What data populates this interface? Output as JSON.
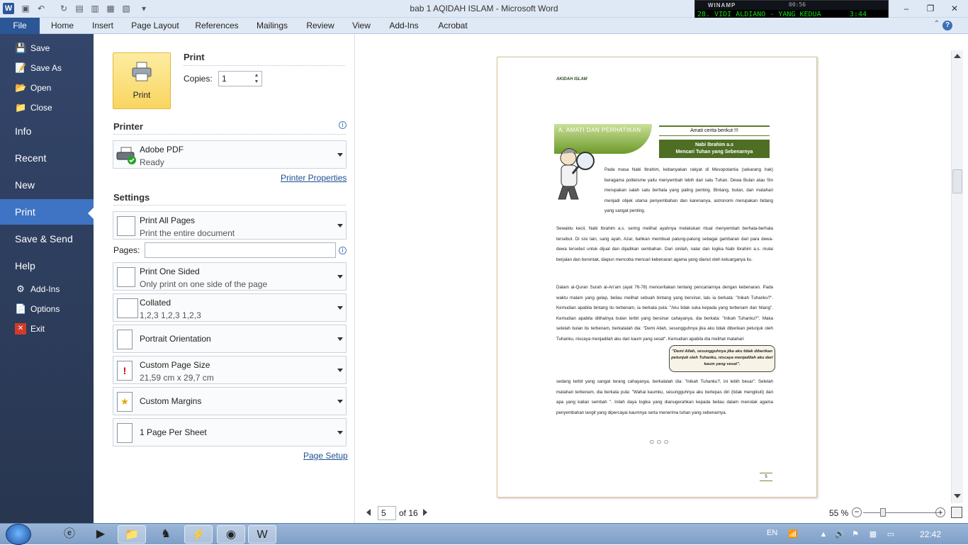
{
  "window": {
    "title": "bab 1 AQIDAH ISLAM  -  Microsoft Word",
    "app_icon": "W"
  },
  "winamp": {
    "label": "WINAMP",
    "clock": "00:56",
    "track": "28. VIDI ALDIANO - YANG KEDUA",
    "time": "3:44"
  },
  "ribbon_tabs": [
    "File",
    "Home",
    "Insert",
    "Page Layout",
    "References",
    "Mailings",
    "Review",
    "View",
    "Add-Ins",
    "Acrobat"
  ],
  "nav": {
    "save": "Save",
    "save_as": "Save As",
    "open": "Open",
    "close": "Close",
    "info": "Info",
    "recent": "Recent",
    "new": "New",
    "print": "Print",
    "save_send": "Save & Send",
    "help": "Help",
    "add_ins": "Add-Ins",
    "options": "Options",
    "exit": "Exit"
  },
  "print_panel": {
    "print_button": "Print",
    "print_heading": "Print",
    "copies_label": "Copies:",
    "copies_value": "1",
    "printer_heading": "Printer",
    "printer_name": "Adobe PDF",
    "printer_status": "Ready",
    "printer_properties": "Printer Properties",
    "settings_heading": "Settings",
    "pages_label": "Pages:",
    "page_setup": "Page Setup",
    "settings": [
      {
        "title": "Print All Pages",
        "subtitle": "Print the entire document"
      },
      {
        "title": "Print One Sided",
        "subtitle": "Only print on one side of the page"
      },
      {
        "title": "Collated",
        "subtitle": "1,2,3    1,2,3    1,2,3"
      },
      {
        "title": "Portrait Orientation",
        "subtitle": ""
      },
      {
        "title": "Custom Page Size",
        "subtitle": "21,59 cm x 29,7 cm"
      },
      {
        "title": "Custom Margins",
        "subtitle": ""
      },
      {
        "title": "1 Page Per Sheet",
        "subtitle": ""
      }
    ]
  },
  "document": {
    "header": "AKIDAH ISLAM",
    "banner": "A. AMATI DAN PERHATIKAN",
    "box_top": "Amati cerita berikut !!!",
    "box_title_1": "Nabi Ibrahim a.s",
    "box_title_2": "Mencari Tuhan yang Sebenarnya",
    "para1": "Pada masa Nabi Ibrahim, kebanyakan rakyat di Mesopotamia (sekarang Irak) beragama politeisme yaitu menyembah lebih dari satu Tuhan. Dewa Bulan atau Sin merupakan salah satu berhala yang paling penting. Bintang, bulan, dan matahari menjadi objek utama penyembahan dan karenanya, astronomi merupakan bidang yang sangat penting.",
    "para2": "Sewaktu kecil, Nabi Ibrahim a.s. sering melihat ayahnya melakukan ritual menyembah berhala-berhala tersebut. Di sisi lain, sang ayah, Azar, bahkan membuat patung-patung sebagai gambaran dari para dewa-dewa tersebut untuk dijual dan dijadikan sembahan. Dari sinilah, nalar dan logika Nabi Ibrahim a.s. mulai berjalan dan berontak, diapun mencoba mencari kebenaran agama yang dianut oleh keluarganya itu.",
    "para3": "Dalam al-Quran Surah al-An'am (ayat 76-78) menceritakan tentang pencariannya dengan kebenaran. Pada waktu malam yang gelap, beliau melihat sebuah bintang yang bersinar, lalu ia berkata: \"Inikah Tuhanku?\". Kemudian apabila bintang itu terbenam, ia berkata pula: \"Aku tidak suka kepada yang terbenam dan hilang\". Kemudian apabila dilihatnya bulan terbit yang bersinar cahayanya, dia berkata: \"Inikah Tuhanku?\". Maka setelah bulan itu terbenam, berkatalah dia: \"Demi Allah, sesungguhnya jika aku tidak diberikan petunjuk oleh Tuhanku, niscaya menjadilah aku dari kaum yang sesat\". Kemudian apabila dia melihat matahari",
    "para3_cont": "sedang terbit yang sangat terang cahayanya, berkatalah dia: \"Inikah Tuhanku?, ini lebih besar\". Setelah matahari terbenam, dia berkata pula: \"Wahai kaumku, sesungguhnya aku berlepas diri (tidak mengikuti) dari apa yang kalian sembah \". Inilah daya logika yang dianugerahkan kepada beliau dalam menolak agama penyembahan langit yang dipercayai kaumnya serta menerima tuhan yang sebenarnya.",
    "quote": "\"Demi Allah, sesungguhnya jika aku tidak diberikan petunjuk oleh Tuhanku, niscaya menjadilah aku dari kaum yang sesat\".",
    "ornament": "○○○",
    "page_number": "5"
  },
  "page_nav": {
    "current_page": "5",
    "of_pages": "of 16",
    "zoom": "55 %"
  },
  "taskbar": {
    "lang": "EN",
    "clock": "22:42"
  }
}
